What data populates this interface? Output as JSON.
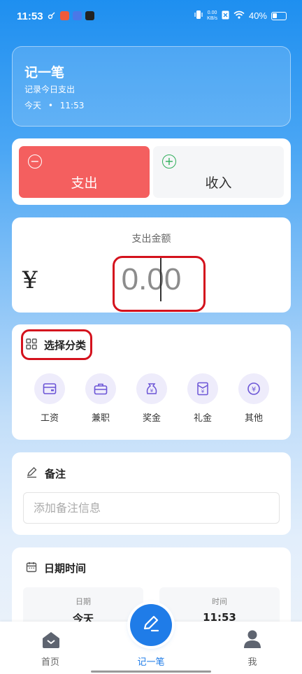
{
  "status_bar": {
    "time": "11:53",
    "net_speed_value": "0.00",
    "net_speed_unit": "KB/s",
    "battery": "40%"
  },
  "hero": {
    "title": "记一笔",
    "subtitle": "记录今日支出",
    "date_label": "今天",
    "separator": "•",
    "time": "11:53"
  },
  "type_toggle": {
    "expense_label": "支出",
    "income_label": "收入",
    "selected": "支出",
    "expense_color": "#f45f5f",
    "income_icon_color": "#2fae5a"
  },
  "amount": {
    "label": "支出金额",
    "currency": "¥",
    "value": "0.00"
  },
  "category": {
    "title": "选择分类",
    "items": [
      {
        "label": "工资",
        "icon": "wallet-icon"
      },
      {
        "label": "兼职",
        "icon": "briefcase-icon"
      },
      {
        "label": "奖金",
        "icon": "money-bag-icon"
      },
      {
        "label": "礼金",
        "icon": "red-envelope-icon"
      },
      {
        "label": "其他",
        "icon": "yuan-coin-icon"
      }
    ]
  },
  "note": {
    "title": "备注",
    "placeholder": "添加备注信息"
  },
  "datetime": {
    "title": "日期时间",
    "date_caption": "日期",
    "date_value": "今天",
    "time_caption": "时间",
    "time_value": "11:53"
  },
  "tabbar": {
    "home": "首页",
    "record": "记一笔",
    "me": "我",
    "active": "记一笔",
    "accent": "#1f7ce8"
  },
  "annotations": {
    "highlight_color": "#d4121d"
  }
}
